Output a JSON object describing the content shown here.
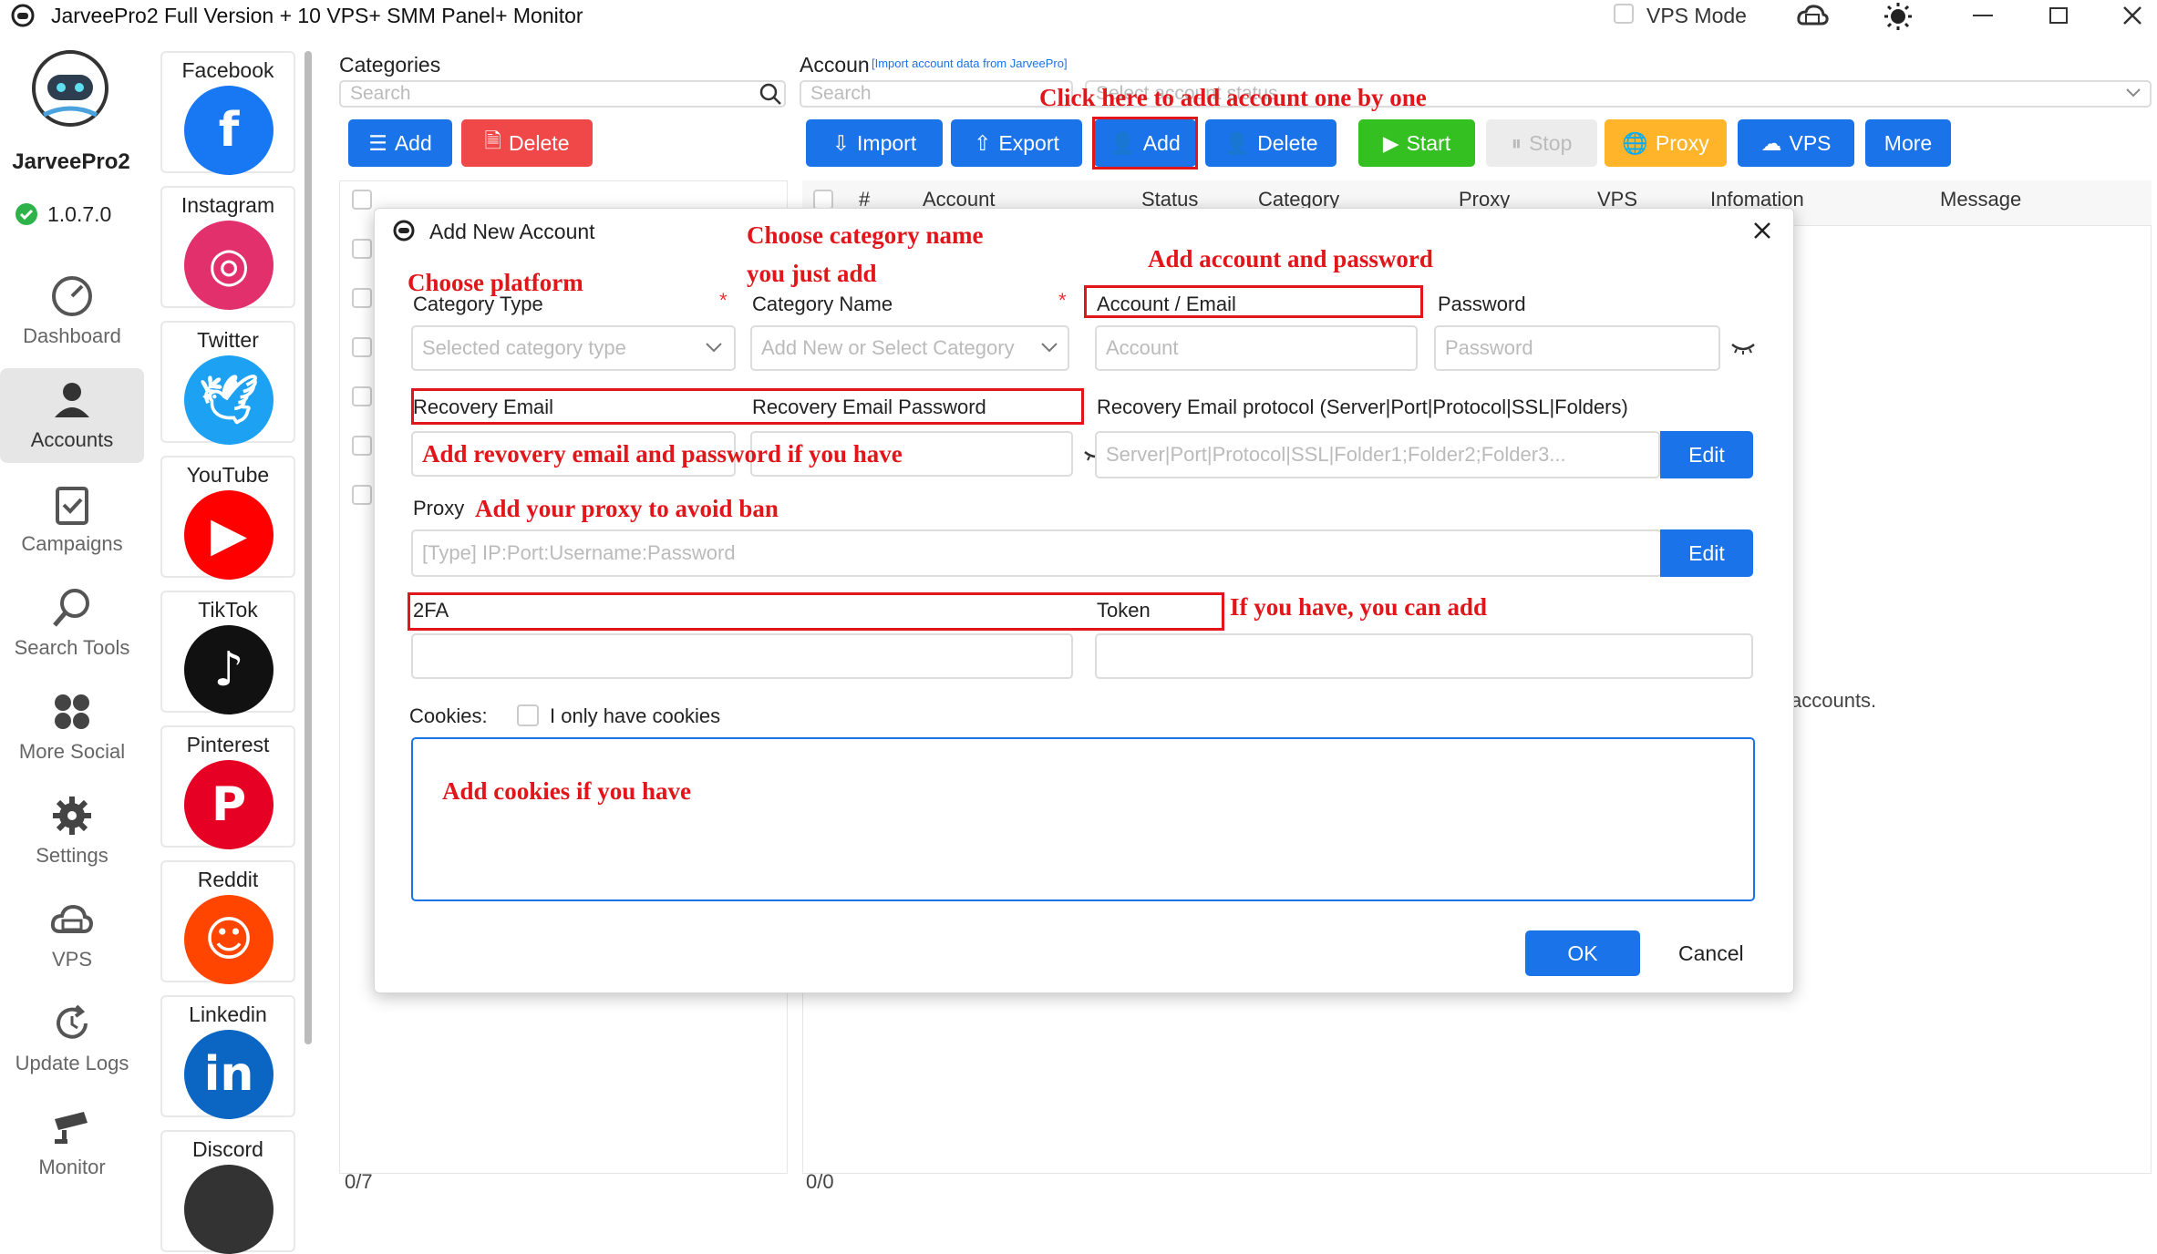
{
  "window": {
    "title": "JarveePro2 Full Version + 10 VPS+ SMM Panel+ Monitor",
    "vps_mode_label": "VPS Mode"
  },
  "brand": {
    "name": "JarveePro2",
    "version": "1.0.7.0"
  },
  "nav": [
    {
      "label": "Dashboard",
      "icon": "dashboard-icon"
    },
    {
      "label": "Accounts",
      "icon": "accounts-icon",
      "active": true
    },
    {
      "label": "Campaigns",
      "icon": "campaigns-icon"
    },
    {
      "label": "Search Tools",
      "icon": "search-icon"
    },
    {
      "label": "More Social",
      "icon": "more-social-icon"
    },
    {
      "label": "Settings",
      "icon": "gear-icon"
    },
    {
      "label": "VPS",
      "icon": "vps-icon"
    },
    {
      "label": "Update Logs",
      "icon": "update-logs-icon"
    },
    {
      "label": "Monitor",
      "icon": "monitor-icon"
    }
  ],
  "social": [
    {
      "label": "Facebook",
      "color": "#1877f2",
      "glyph": "f"
    },
    {
      "label": "Instagram",
      "color": "#e1306c",
      "glyph": "◎"
    },
    {
      "label": "Twitter",
      "color": "#1da1f2",
      "glyph": "🕊"
    },
    {
      "label": "YouTube",
      "color": "#ff0000",
      "glyph": "▶"
    },
    {
      "label": "TikTok",
      "color": "#111111",
      "glyph": "♪"
    },
    {
      "label": "Pinterest",
      "color": "#e60023",
      "glyph": "P"
    },
    {
      "label": "Reddit",
      "color": "#ff4500",
      "glyph": "☺"
    },
    {
      "label": "Linkedin",
      "color": "#0a66c2",
      "glyph": "in"
    },
    {
      "label": "Discord",
      "color": "#333333",
      "glyph": ""
    }
  ],
  "categories": {
    "title": "Categories",
    "search_placeholder": "Search",
    "add": "Add",
    "delete": "Delete",
    "count": "0/7"
  },
  "accounts": {
    "title": "Accoun",
    "import_link": "[Import account data from JarveePro]",
    "search_placeholder": "Search",
    "status_placeholder": "Select account status",
    "buttons": {
      "import": "Import",
      "export": "Export",
      "add": "Add",
      "delete": "Delete",
      "start": "Start",
      "stop": "Stop",
      "proxy": "Proxy",
      "vps": "VPS",
      "more": "More"
    },
    "columns": [
      "#",
      "Account",
      "Status",
      "Category",
      "Proxy",
      "VPS",
      "Infomation",
      "Message"
    ],
    "empty_text": "accounts.",
    "count": "0/0"
  },
  "dialog": {
    "title": "Add New Account",
    "category_type_label": "Category Type",
    "category_type_placeholder": "Selected category type",
    "category_name_label": "Category Name",
    "category_name_placeholder": "Add New or Select Category",
    "account_label": "Account / Email",
    "password_label": "Password",
    "account_placeholder": "Account",
    "password_placeholder": "Password",
    "recovery_email_label": "Recovery Email",
    "recovery_password_label": "Recovery Email Password",
    "recovery_protocol_label": "Recovery Email protocol (Server|Port|Protocol|SSL|Folders)",
    "recovery_protocol_placeholder": "Server|Port|Protocol|SSL|Folder1;Folder2;Folder3...",
    "edit": "Edit",
    "proxy_label": "Proxy",
    "proxy_placeholder": "[Type] IP:Port:Username:Password",
    "twofa_label": "2FA",
    "token_label": "Token",
    "cookies_label": "Cookies:",
    "cookies_only_label": "I only have cookies",
    "ok": "OK",
    "cancel": "Cancel"
  },
  "annotations": {
    "click_add": "Click here to add account one by one",
    "choose_category_1": "Choose category name",
    "choose_category_2": "you just add",
    "choose_platform": "Choose platform",
    "add_account": "Add account and password",
    "add_recovery": "Add revovery email and password if you have",
    "add_proxy": "Add your proxy to avoid ban",
    "if_have": "If you have, you can add",
    "add_cookies": "Add cookies if you have"
  }
}
